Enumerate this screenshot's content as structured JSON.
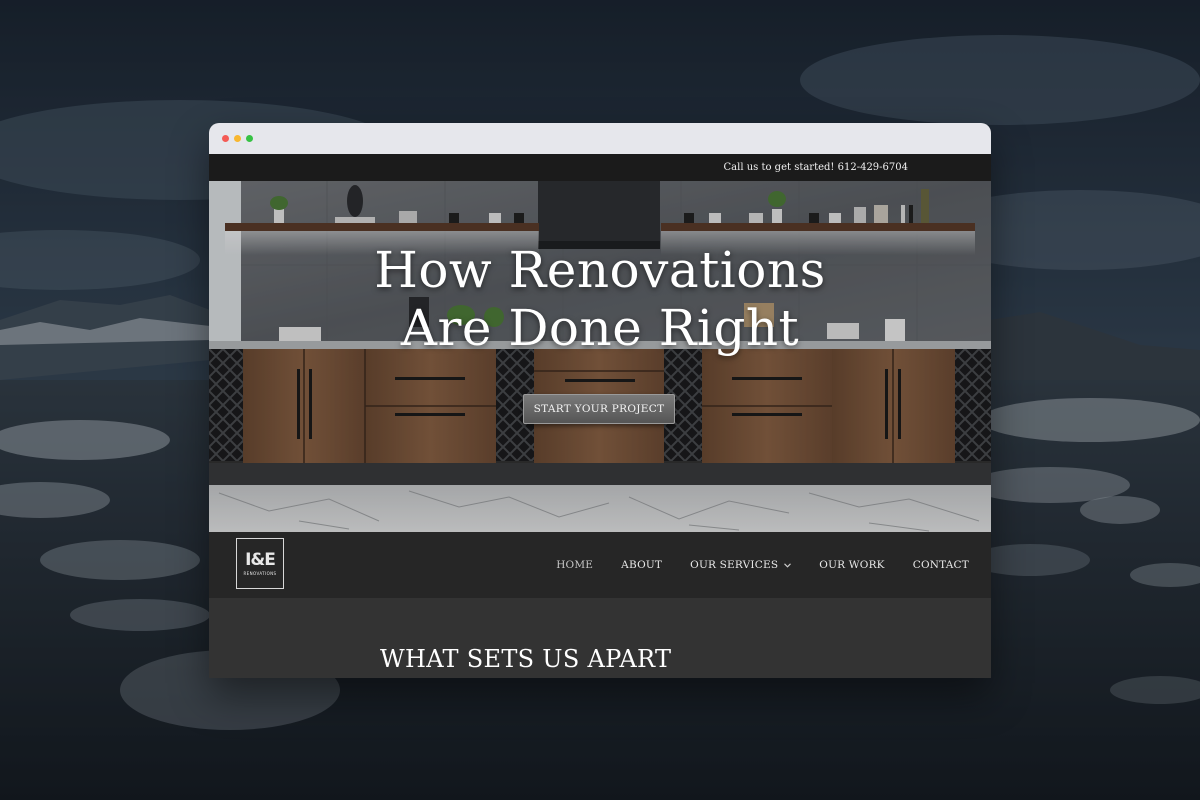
{
  "topbar": {
    "call_text": "Call us to get started! 612-429-6704"
  },
  "hero": {
    "title_line1": "How Renovations",
    "title_line2": "Are Done Right",
    "cta_label": "START YOUR PROJECT"
  },
  "logo": {
    "mark": "I&E",
    "subtitle": "RENOVATIONS"
  },
  "nav": {
    "items": [
      {
        "label": "HOME"
      },
      {
        "label": "ABOUT"
      },
      {
        "label": "OUR SERVICES",
        "has_dropdown": true,
        "chevron": "chevron-down-icon"
      },
      {
        "label": "OUR WORK"
      },
      {
        "label": "CONTACT"
      }
    ]
  },
  "section": {
    "title": "WHAT SETS US APART"
  },
  "colors": {
    "topbar_bg": "#1b1b1b",
    "nav_bg": "#262626",
    "section_bg": "#333333",
    "window_dots": [
      "#f45b55",
      "#f8b730",
      "#37c244"
    ]
  }
}
